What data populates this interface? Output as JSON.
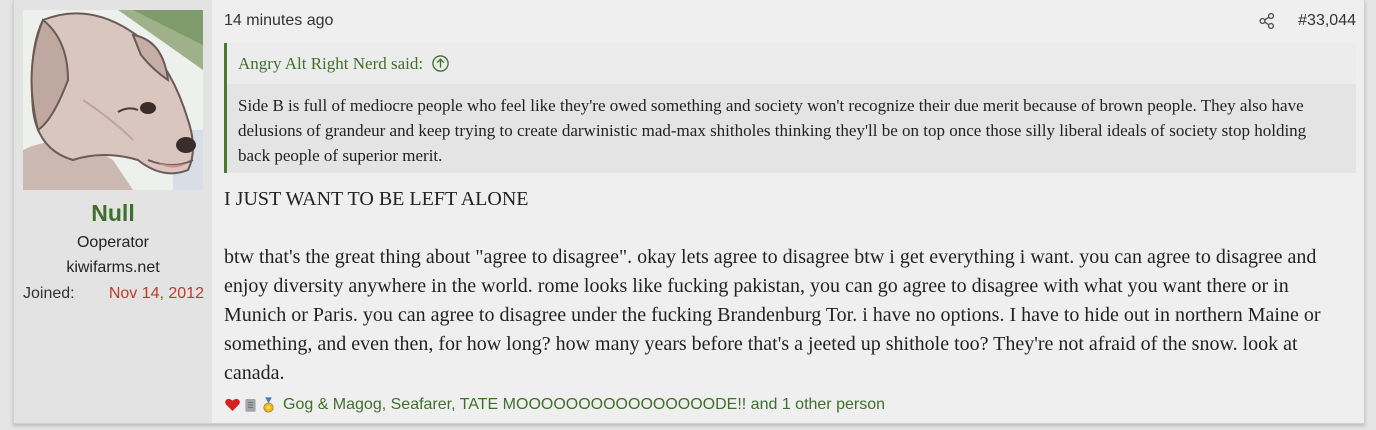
{
  "user": {
    "name": "Null",
    "title": "Ooperator",
    "site": "kiwifarms.net",
    "joined_label": "Joined:",
    "joined_date": "Nov 14, 2012"
  },
  "post": {
    "time": "14 minutes ago",
    "number": "#33,044"
  },
  "quote": {
    "author_said": "Angry Alt Right Nerd said:",
    "text": "Side B is full of mediocre people who feel like they're owed something and society won't recognize their due merit because of brown people. They also have delusions of grandeur and keep trying to create darwinistic mad-max shitholes thinking they'll be on top once those silly liberal ideals of society stop holding back people of superior merit."
  },
  "message": {
    "line1": "I JUST WANT TO BE LEFT ALONE",
    "paragraph2": "btw that's the great thing about \"agree to disagree\". okay lets agree to disagree btw i get everything i want. you can agree to disagree and enjoy diversity anywhere in the world. rome looks like fucking pakistan, you can go agree to disagree with what you want there or in Munich or Paris. you can agree to disagree under the fucking Brandenburg Tor. i have no options. I have to hide out in northern Maine or something, and even then, for how long? how many years before that's a jeeted up shithole too? They're not afraid of the snow. look at canada."
  },
  "reactions": {
    "icons": [
      "heart-icon",
      "scroll-icon",
      "medal-icon"
    ],
    "text": "Gog & Magog, Seafarer, TATE MOOOOOOOOOOOOOOOODE!! and 1 other person"
  },
  "colors": {
    "accent_green": "#3f6f2b",
    "date_red": "#c0392b"
  }
}
